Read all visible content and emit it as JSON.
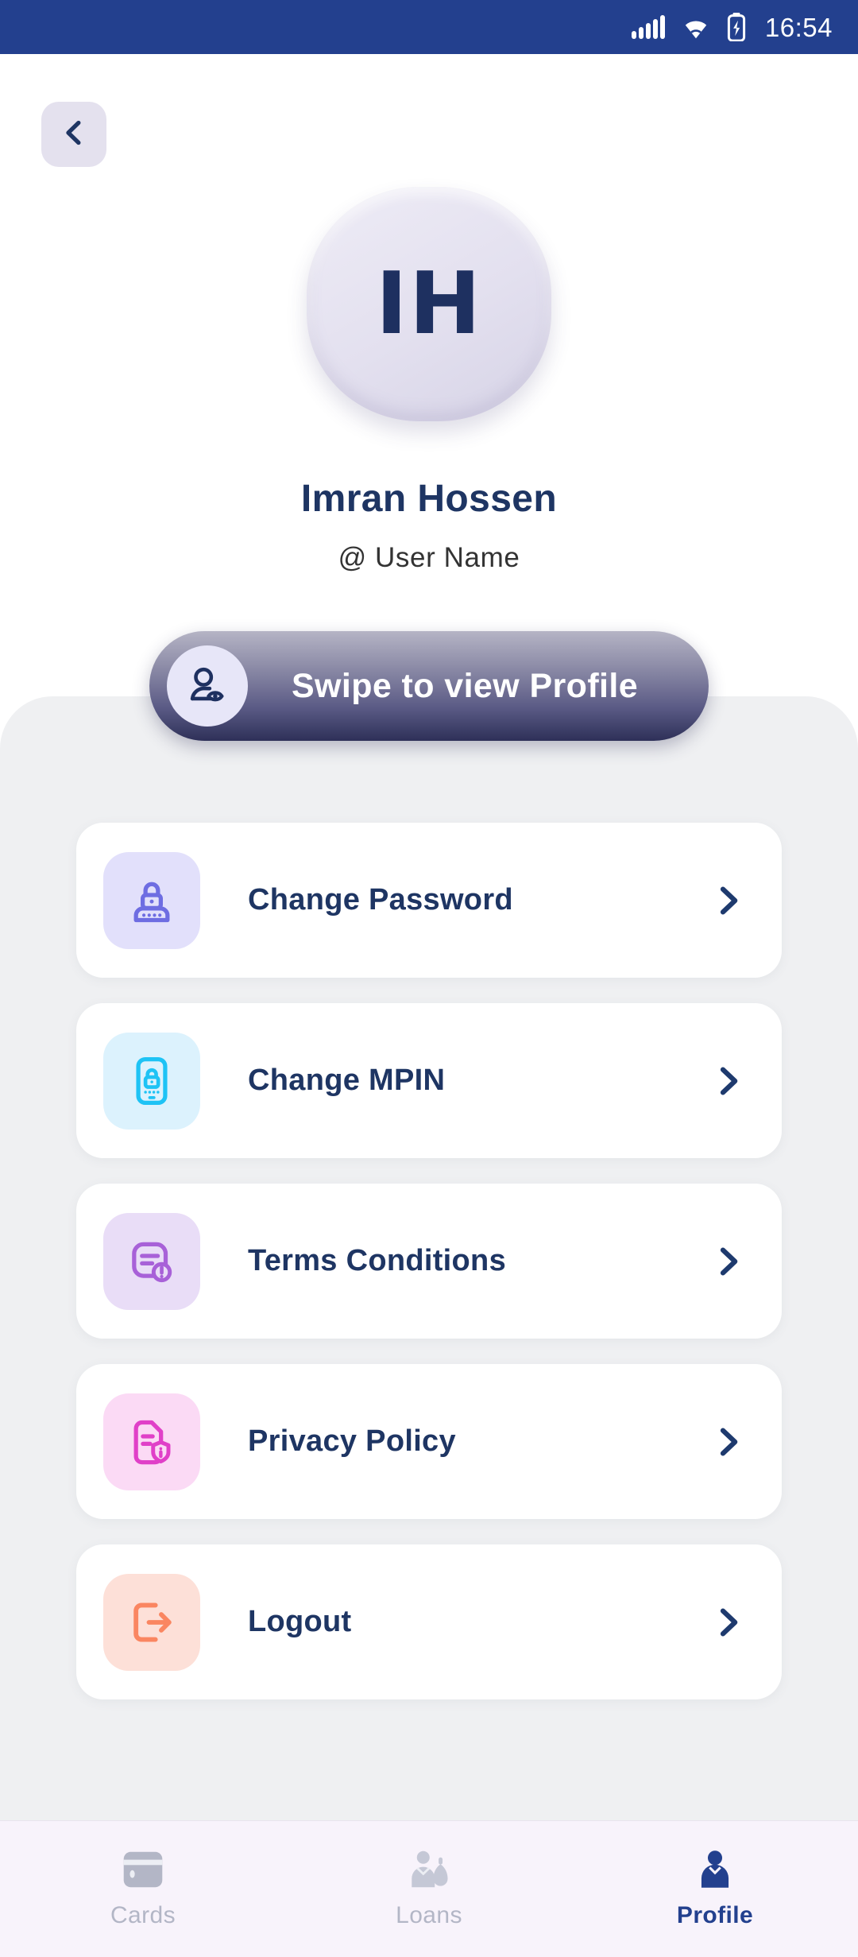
{
  "status_bar": {
    "time": "16:54",
    "signal_icon": "signal-bars-icon",
    "wifi_icon": "wifi-icon",
    "battery_icon": "battery-charging-icon",
    "background_color": "#23408e"
  },
  "header": {
    "back_icon": "chevron-left-icon",
    "avatar": {
      "initials": "IH",
      "label": "avatar"
    },
    "name": "Imran Hossen",
    "username": "@ User Name"
  },
  "swipe_button": {
    "label": "Swipe to view Profile",
    "icon": "person-view-icon",
    "gradient_from": "#b5b4c5",
    "gradient_to": "#2e3058"
  },
  "menu": {
    "items": [
      {
        "label": "Change Password",
        "icon": "lock-keypad-icon",
        "tile_color": "#e2e0fb",
        "icon_color": "#6e6de2",
        "chevron_icon": "chevron-right-icon"
      },
      {
        "label": "Change MPIN",
        "icon": "phone-lock-icon",
        "tile_color": "#dcf2fd",
        "icon_color": "#1ec3f5",
        "chevron_icon": "chevron-right-icon"
      },
      {
        "label": "Terms Conditions",
        "icon": "document-alert-icon",
        "tile_color": "#e9ddf7",
        "icon_color": "#a861d8",
        "chevron_icon": "chevron-right-icon"
      },
      {
        "label": "Privacy Policy",
        "icon": "document-shield-icon",
        "tile_color": "#fbdaf5",
        "icon_color": "#e040c8",
        "chevron_icon": "chevron-right-icon"
      },
      {
        "label": "Logout",
        "icon": "logout-arrow-icon",
        "tile_color": "#fde0d8",
        "icon_color": "#fa8661",
        "chevron_icon": "chevron-right-icon"
      }
    ]
  },
  "bottom_nav": {
    "items": [
      {
        "label": "Cards",
        "icon": "credit-card-icon",
        "active": false
      },
      {
        "label": "Loans",
        "icon": "loan-person-icon",
        "active": false
      },
      {
        "label": "Profile",
        "icon": "person-icon",
        "active": true
      }
    ],
    "active_color": "#23408e",
    "inactive_color": "#b3b6c6"
  },
  "colors": {
    "navy": "#1e3563",
    "panel": "#eff0f2",
    "card": "#ffffff"
  }
}
